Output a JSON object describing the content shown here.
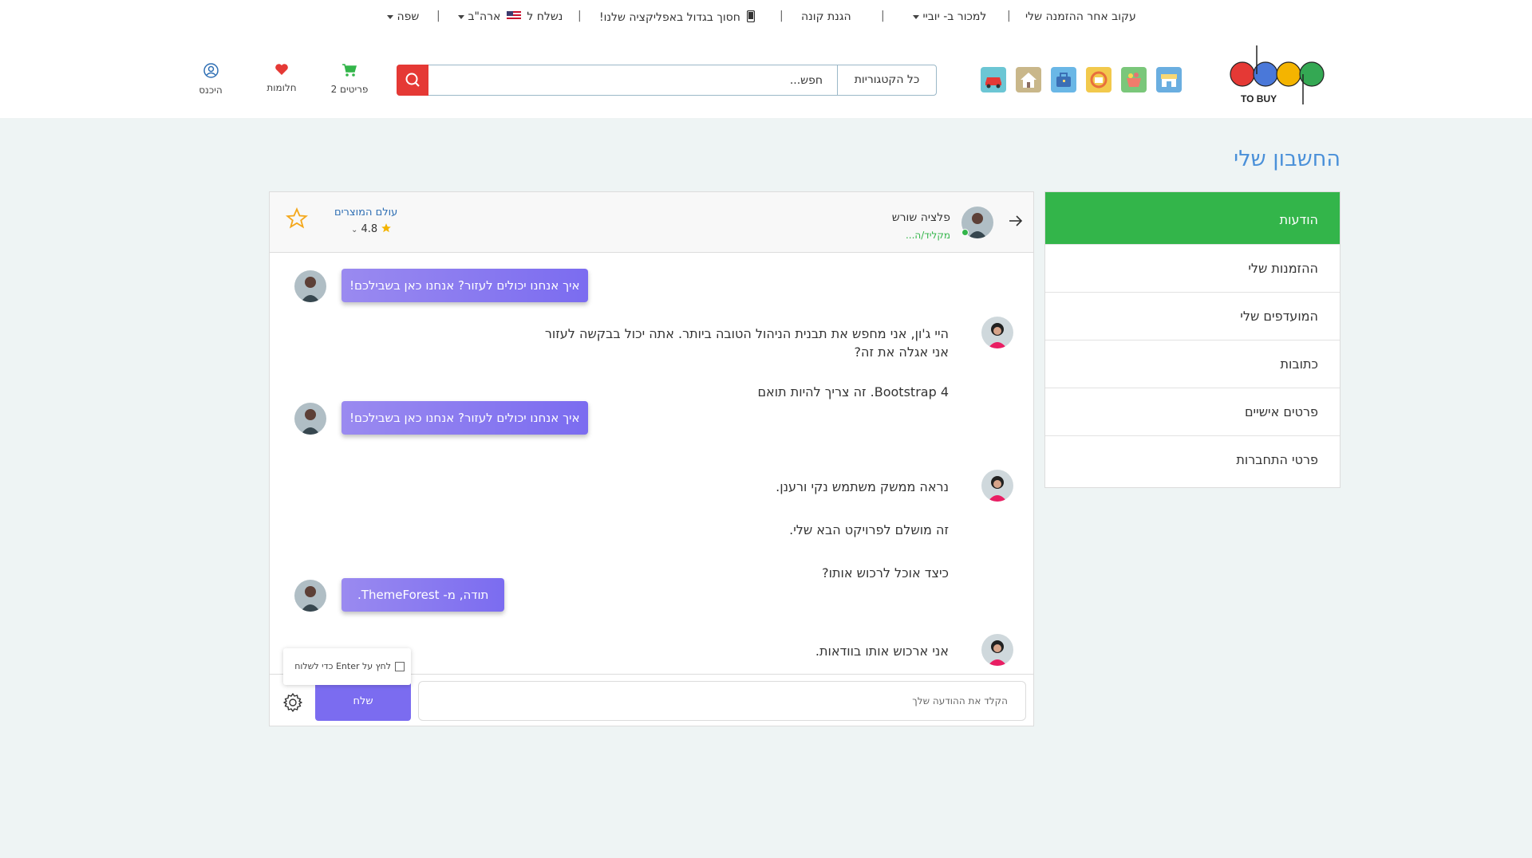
{
  "topbar": {
    "track_order": "עקוב אחר ההזמנה שלי",
    "sell": "למכור ב- יוביי",
    "buyer_protection": "הגנת קונה",
    "app_promo": "חסוך בגדול באפליקציה שלנו!",
    "ship_to_prefix": "נשלח ל",
    "ship_to_country": "ארה\"ב",
    "language": "שפה"
  },
  "header": {
    "logo_text": "TO BUY",
    "categories": [
      {
        "name": "shop-category-icon",
        "color": "#6aaee0"
      },
      {
        "name": "basket-category-icon",
        "color": "#7ac77a"
      },
      {
        "name": "gifts-category-icon",
        "color": "#f2c94c"
      },
      {
        "name": "briefcase-category-icon",
        "color": "#6ab7e6"
      },
      {
        "name": "house-category-icon",
        "color": "#c9b78a"
      },
      {
        "name": "car-category-icon",
        "color": "#6cc6d4"
      }
    ],
    "search_placeholder": "חפש...",
    "all_categories": "כל הקטגוריות",
    "cart_label": "פריטים 2",
    "wishlist_label": "חלומות",
    "login_label": "היכנס"
  },
  "page_title": "החשבון שלי",
  "sidebar": {
    "items": [
      {
        "label": "הודעות",
        "active": true
      },
      {
        "label": "ההזמנות שלי",
        "active": false
      },
      {
        "label": "המועדפים שלי",
        "active": false
      },
      {
        "label": "כתובות",
        "active": false
      },
      {
        "label": "פרטים אישיים",
        "active": false
      },
      {
        "label": "פרטי התחברות",
        "active": false
      }
    ]
  },
  "chat": {
    "contact_name": "פלציה שורש",
    "typing": "מקליד/ה...",
    "store_name": "עולם המוצרים",
    "store_rating": "4.8",
    "messages": [
      {
        "from": "agent",
        "text": "איך אנחנו יכולים לעזור? אנחנו כאן בשבילכם!"
      },
      {
        "from": "user",
        "text": "היי ג'ון, אני מחפש את תבנית הניהול הטובה ביותר. אתה יכול בבקשה לעזור"
      },
      {
        "from": "user",
        "text": "אני אגלה את זה?"
      },
      {
        "from": "user",
        "text": "Bootstrap 4. זה צריך להיות תואם"
      },
      {
        "from": "agent",
        "text": "איך אנחנו יכולים לעזור? אנחנו כאן בשבילכם!"
      },
      {
        "from": "user",
        "text": "נראה ממשק משתמש נקי ורענן."
      },
      {
        "from": "user",
        "text": "זה מושלם לפרויקט הבא שלי."
      },
      {
        "from": "user",
        "text": "כיצד אוכל לרכוש אותו?"
      },
      {
        "from": "agent",
        "text": "תודה, מ- ThemeForest."
      },
      {
        "from": "user",
        "text": "אני ארכוש אותו בוודאות."
      }
    ],
    "input_placeholder": "הקלד את ההודעה שלך",
    "send_label": "שלח",
    "enter_to_send": "לחץ על Enter כדי לשלוח"
  },
  "colors": {
    "accent_green": "#33b54a",
    "link_blue": "#4a90d9",
    "send_purple": "#7b6cf0",
    "search_red": "#e53935"
  }
}
